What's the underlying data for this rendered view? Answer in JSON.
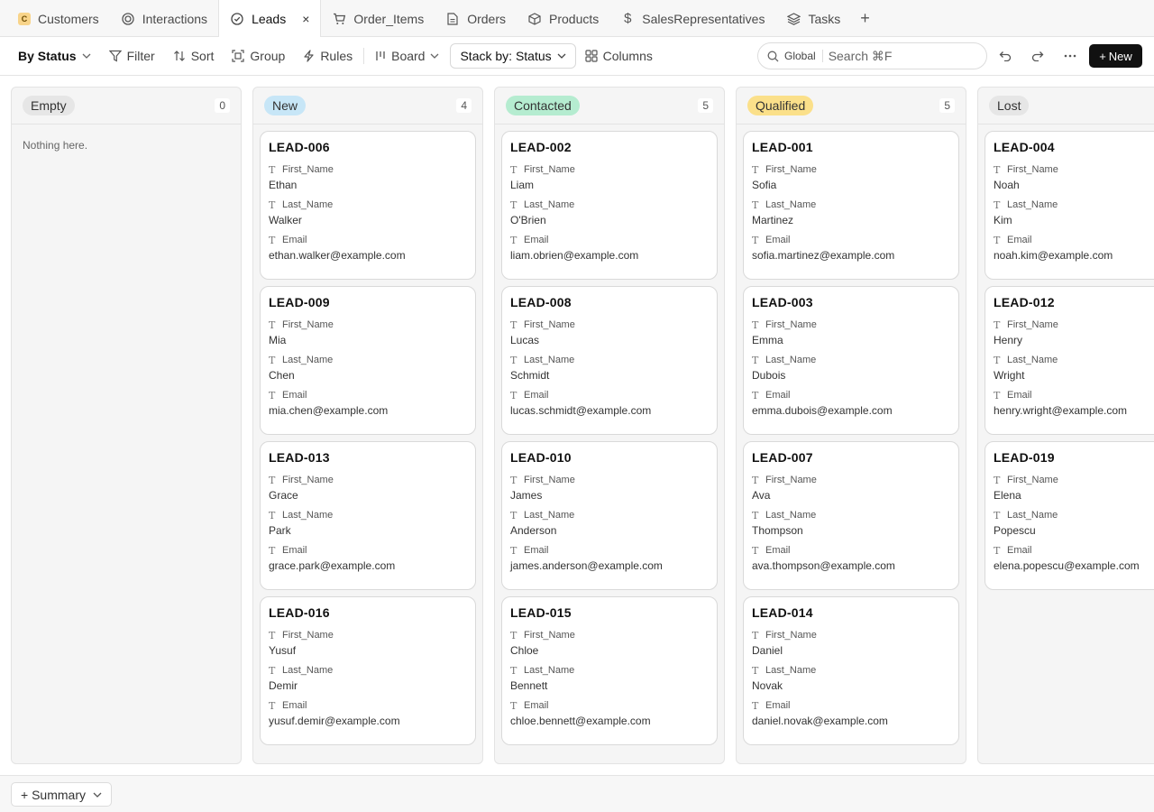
{
  "tabs": [
    {
      "label": "Customers",
      "icon": "letter-c-icon",
      "letter": "C"
    },
    {
      "label": "Interactions",
      "icon": "target-icon"
    },
    {
      "label": "Leads",
      "icon": "check-circle-icon",
      "active": true
    },
    {
      "label": "Order_Items",
      "icon": "cart-icon"
    },
    {
      "label": "Orders",
      "icon": "document-icon"
    },
    {
      "label": "Products",
      "icon": "box-icon"
    },
    {
      "label": "SalesRepresentatives",
      "icon": "dollar-icon"
    },
    {
      "label": "Tasks",
      "icon": "layers-icon"
    }
  ],
  "toolbar": {
    "view_label": "By Status",
    "filter_label": "Filter",
    "sort_label": "Sort",
    "group_label": "Group",
    "rules_label": "Rules",
    "board_label": "Board",
    "stack_label": "Stack by: Status",
    "columns_label": "Columns",
    "search_scope": "Global",
    "search_placeholder": "Search ⌘F",
    "new_label": "New"
  },
  "columns": [
    {
      "name": "Empty",
      "count": "0",
      "color": "#e6e6e6",
      "empty_text": "Nothing here.",
      "cards": []
    },
    {
      "name": "New",
      "count": "4",
      "color": "#c7e6f7",
      "cards": [
        {
          "id": "LEAD-006",
          "first": "Ethan",
          "last": "Walker",
          "email": "ethan.walker@example.com"
        },
        {
          "id": "LEAD-009",
          "first": "Mia",
          "last": "Chen",
          "email": "mia.chen@example.com"
        },
        {
          "id": "LEAD-013",
          "first": "Grace",
          "last": "Park",
          "email": "grace.park@example.com"
        },
        {
          "id": "LEAD-016",
          "first": "Yusuf",
          "last": "Demir",
          "email": "yusuf.demir@example.com"
        }
      ]
    },
    {
      "name": "Contacted",
      "count": "5",
      "color": "#b5ecd0",
      "cards": [
        {
          "id": "LEAD-002",
          "first": "Liam",
          "last": "O'Brien",
          "email": "liam.obrien@example.com"
        },
        {
          "id": "LEAD-008",
          "first": "Lucas",
          "last": "Schmidt",
          "email": "lucas.schmidt@example.com"
        },
        {
          "id": "LEAD-010",
          "first": "James",
          "last": "Anderson",
          "email": "james.anderson@example.com"
        },
        {
          "id": "LEAD-015",
          "first": "Chloe",
          "last": "Bennett",
          "email": "chloe.bennett@example.com"
        }
      ]
    },
    {
      "name": "Qualified",
      "count": "5",
      "color": "#fbe08a",
      "cards": [
        {
          "id": "LEAD-001",
          "first": "Sofia",
          "last": "Martinez",
          "email": "sofia.martinez@example.com"
        },
        {
          "id": "LEAD-003",
          "first": "Emma",
          "last": "Dubois",
          "email": "emma.dubois@example.com"
        },
        {
          "id": "LEAD-007",
          "first": "Ava",
          "last": "Thompson",
          "email": "ava.thompson@example.com"
        },
        {
          "id": "LEAD-014",
          "first": "Daniel",
          "last": "Novak",
          "email": "daniel.novak@example.com"
        }
      ]
    },
    {
      "name": "Lost",
      "count": "",
      "color": "#e6e6e6",
      "cards": [
        {
          "id": "LEAD-004",
          "first": "Noah",
          "last": "Kim",
          "email": "noah.kim@example.com"
        },
        {
          "id": "LEAD-012",
          "first": "Henry",
          "last": "Wright",
          "email": "henry.wright@example.com"
        },
        {
          "id": "LEAD-019",
          "first": "Elena",
          "last": "Popescu",
          "email": "elena.popescu@example.com"
        }
      ]
    }
  ],
  "field_labels": {
    "first": "First_Name",
    "last": "Last_Name",
    "email": "Email"
  },
  "footer": {
    "summary_label": "Summary"
  }
}
